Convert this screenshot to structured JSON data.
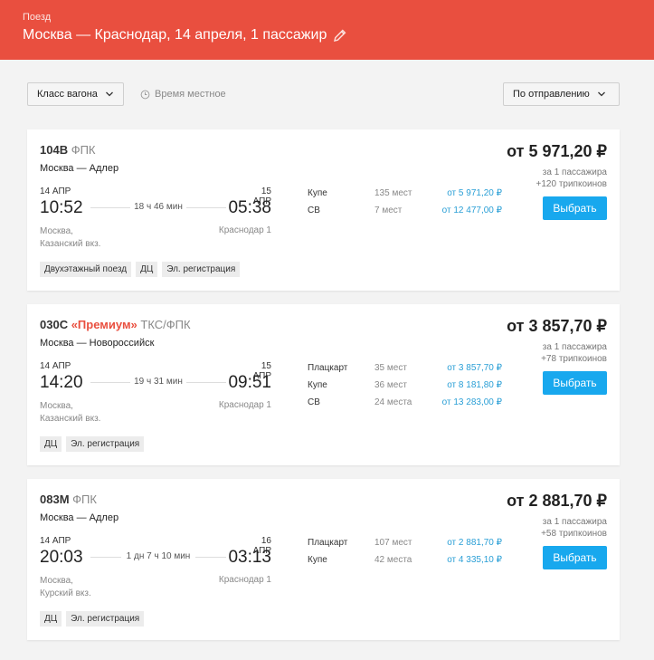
{
  "header": {
    "kind": "Поезд",
    "title": "Москва — Краснодар,  14 апреля,  1 пассажир"
  },
  "filters": {
    "car_class": "Класс вагона",
    "local_time": "Время местное",
    "sort": "По отправлению"
  },
  "trains": [
    {
      "number": "104В",
      "premium": "",
      "carrier": "ФПК",
      "route": "Москва — Адлер",
      "dep_date": "14 АПР",
      "dep_time": "10:52",
      "duration": "18 ч 46 мин",
      "arr_date": "15 АПР",
      "arr_time": "05:38",
      "dep_station_1": "Москва,",
      "dep_station_2": "Казанский вкз.",
      "arr_station": "Краснодар 1",
      "tags": [
        "Двухэтажный поезд",
        "ДЦ",
        "Эл. регистрация"
      ],
      "classes": [
        {
          "name": "Купе",
          "seats": "135 мест",
          "price": "от 5 971,20 ₽"
        },
        {
          "name": "СВ",
          "seats": "7 мест",
          "price": "от 12 477,00 ₽"
        }
      ],
      "price": "от 5 971,20 ₽",
      "per": "за 1 пассажира",
      "bonus": "+120 трипкоинов",
      "button": "Выбрать"
    },
    {
      "number": "030С",
      "premium": "«Премиум»",
      "carrier": "ТКС/ФПК",
      "route": "Москва — Новороссийск",
      "dep_date": "14 АПР",
      "dep_time": "14:20",
      "duration": "19 ч 31 мин",
      "arr_date": "15 АПР",
      "arr_time": "09:51",
      "dep_station_1": "Москва,",
      "dep_station_2": "Казанский вкз.",
      "arr_station": "Краснодар 1",
      "tags": [
        "ДЦ",
        "Эл. регистрация"
      ],
      "classes": [
        {
          "name": "Плацкарт",
          "seats": "35 мест",
          "price": "от 3 857,70 ₽"
        },
        {
          "name": "Купе",
          "seats": "36 мест",
          "price": "от 8 181,80 ₽"
        },
        {
          "name": "СВ",
          "seats": "24 места",
          "price": "от 13 283,00 ₽"
        }
      ],
      "price": "от 3 857,70 ₽",
      "per": "за 1 пассажира",
      "bonus": "+78 трипкоинов",
      "button": "Выбрать"
    },
    {
      "number": "083М",
      "premium": "",
      "carrier": "ФПК",
      "route": "Москва — Адлер",
      "dep_date": "14 АПР",
      "dep_time": "20:03",
      "duration": "1 дн 7 ч 10 мин",
      "arr_date": "16 АПР",
      "arr_time": "03:13",
      "dep_station_1": "Москва,",
      "dep_station_2": "Курский вкз.",
      "arr_station": "Краснодар 1",
      "tags": [
        "ДЦ",
        "Эл. регистрация"
      ],
      "classes": [
        {
          "name": "Плацкарт",
          "seats": "107 мест",
          "price": "от 2 881,70 ₽"
        },
        {
          "name": "Купе",
          "seats": "42 места",
          "price": "от 4 335,10 ₽"
        }
      ],
      "price": "от 2 881,70 ₽",
      "per": "за 1 пассажира",
      "bonus": "+58 трипкоинов",
      "button": "Выбрать"
    }
  ]
}
